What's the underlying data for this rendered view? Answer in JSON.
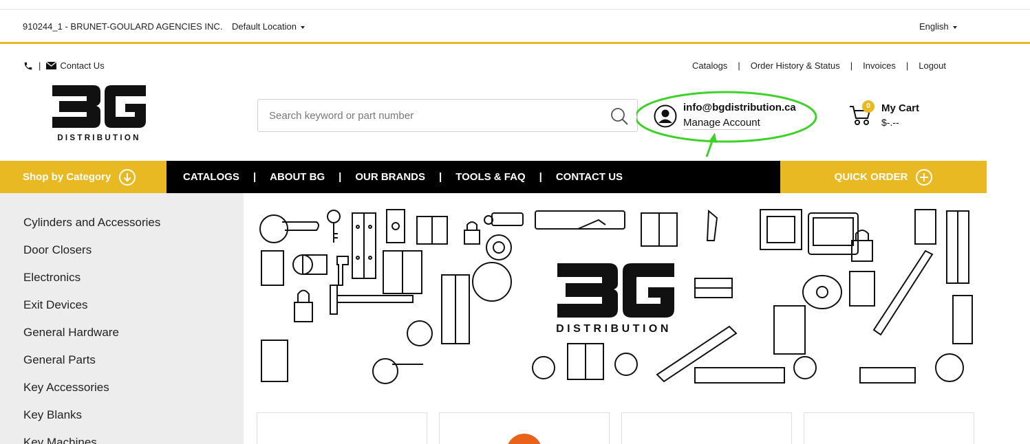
{
  "topbar": {
    "account": "910244_1 - BRUNET-GOULARD AGENCIES INC.",
    "location": "Default Location",
    "language": "English"
  },
  "utility": {
    "contact_label": "Contact Us",
    "links": [
      "Catalogs",
      "Order History & Status",
      "Invoices",
      "Logout"
    ]
  },
  "brand": {
    "logo_text": "DISTRIBUTION",
    "accent_color": "#e9b923"
  },
  "search": {
    "placeholder": "Search keyword or part number"
  },
  "account": {
    "email": "info@bgdistribution.ca",
    "manage_label": "Manage Account"
  },
  "cart": {
    "label": "My Cart",
    "count": "0",
    "total": "$-.--"
  },
  "nav": {
    "shop_by_category": "Shop by Category",
    "links": [
      "CATALOGS",
      "ABOUT BG",
      "OUR BRANDS",
      "TOOLS & FAQ",
      "CONTACT US"
    ],
    "quick_order": "QUICK ORDER"
  },
  "categories": [
    "Cylinders and Accessories",
    "Door Closers",
    "Electronics",
    "Exit Devices",
    "General Hardware",
    "General Parts",
    "Key Accessories",
    "Key Blanks",
    "Key Machines"
  ],
  "hero": {
    "logo_text": "DISTRIBUTION"
  },
  "annotation_color": "#3ed12a"
}
